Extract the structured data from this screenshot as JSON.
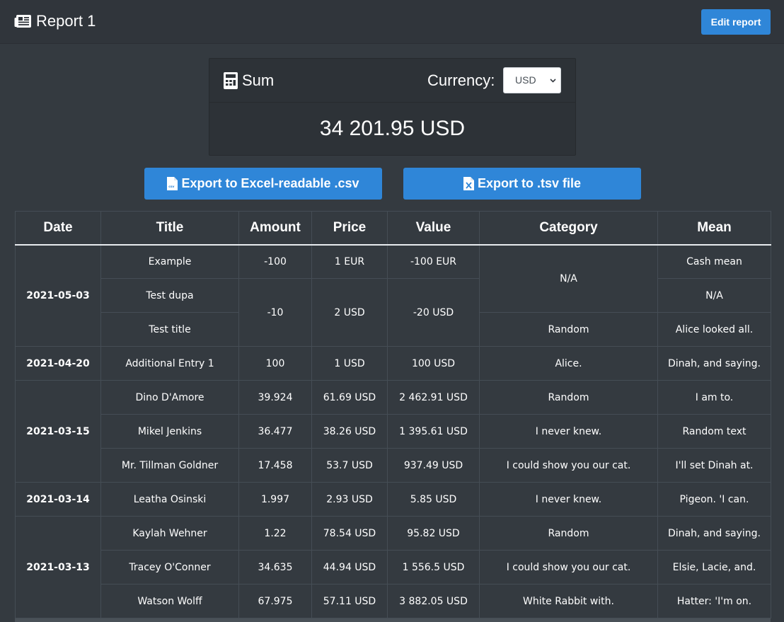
{
  "header": {
    "title": "Report 1",
    "edit_label": "Edit report"
  },
  "sum": {
    "title": "Sum",
    "currency_label": "Currency:",
    "currency_value": "USD",
    "total": "34 201.95 USD"
  },
  "exports": {
    "csv_label": "Export to Excel-readable .csv",
    "tsv_label": "Export to .tsv file"
  },
  "table": {
    "headers": [
      "Date",
      "Title",
      "Amount",
      "Price",
      "Value",
      "Category",
      "Mean"
    ],
    "dates": [
      "2021-05-03",
      "2021-04-20",
      "2021-03-15",
      "2021-03-14",
      "2021-03-13"
    ],
    "rows": [
      {
        "title": "Example",
        "amount": "-100",
        "price": "1 EUR",
        "value": "-100 EUR",
        "category": "N/A",
        "mean": "Cash mean"
      },
      {
        "title": "Test dupa",
        "amount": "-10",
        "price": "2 USD",
        "value": "-20 USD",
        "category": "",
        "mean": "N/A"
      },
      {
        "title": "Test title",
        "amount": "",
        "price": "",
        "value": "",
        "category": "Random",
        "mean": "Alice looked all."
      },
      {
        "title": "Additional Entry 1",
        "amount": "100",
        "price": "1 USD",
        "value": "100 USD",
        "category": "Alice.",
        "mean": "Dinah, and saying."
      },
      {
        "title": "Dino D'Amore",
        "amount": "39.924",
        "price": "61.69 USD",
        "value": "2 462.91 USD",
        "category": "Random",
        "mean": "I am to."
      },
      {
        "title": "Mikel Jenkins",
        "amount": "36.477",
        "price": "38.26 USD",
        "value": "1 395.61 USD",
        "category": "I never knew.",
        "mean": "Random text"
      },
      {
        "title": "Mr. Tillman Goldner",
        "amount": "17.458",
        "price": "53.7 USD",
        "value": "937.49 USD",
        "category": "I could show you our cat.",
        "mean": "I'll set Dinah at."
      },
      {
        "title": "Leatha Osinski",
        "amount": "1.997",
        "price": "2.93 USD",
        "value": "5.85 USD",
        "category": "I never knew.",
        "mean": "Pigeon. 'I can."
      },
      {
        "title": "Kaylah Wehner",
        "amount": "1.22",
        "price": "78.54 USD",
        "value": "95.82 USD",
        "category": "Random",
        "mean": "Dinah, and saying."
      },
      {
        "title": "Tracey O'Conner",
        "amount": "34.635",
        "price": "44.94 USD",
        "value": "1 556.5 USD",
        "category": "I could show you our cat.",
        "mean": "Elsie, Lacie, and."
      },
      {
        "title": "Watson Wolff",
        "amount": "67.975",
        "price": "57.11 USD",
        "value": "3 882.05 USD",
        "category": "White Rabbit with.",
        "mean": "Hatter: 'I'm on."
      }
    ]
  }
}
